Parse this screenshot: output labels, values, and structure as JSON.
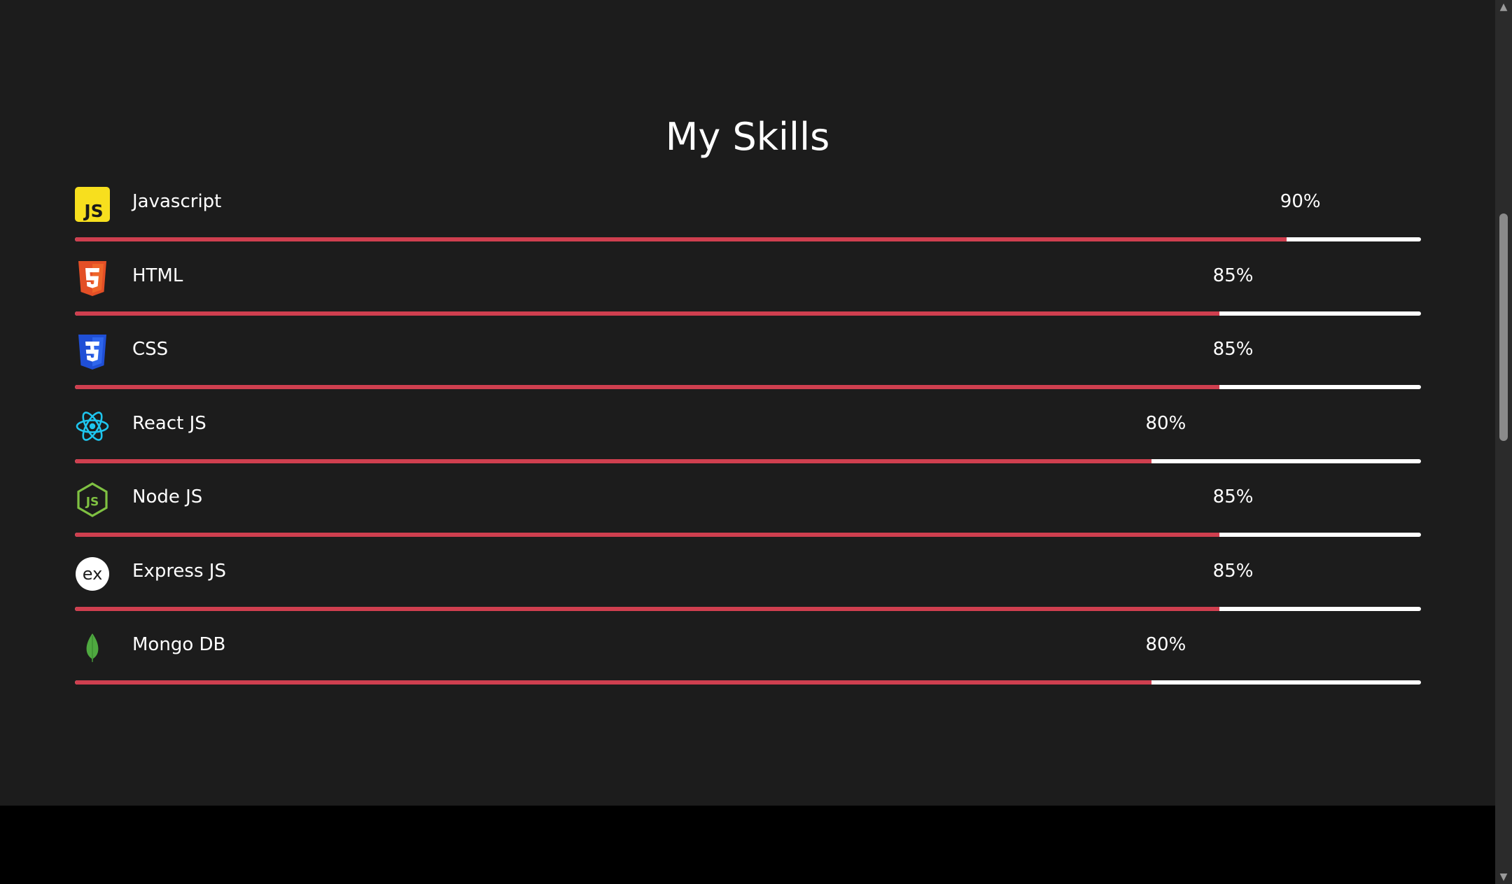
{
  "section": {
    "title": "My Skills"
  },
  "colors": {
    "background": "#1c1c1c",
    "bar_fill": "#cf3f4f",
    "bar_track": "#ffffff",
    "text": "#ffffff"
  },
  "skills": [
    {
      "name": "Javascript",
      "percent_label": "90%",
      "level": 0.9,
      "icon": "javascript-icon"
    },
    {
      "name": "HTML",
      "percent_label": "85%",
      "level": 0.85,
      "icon": "html5-icon"
    },
    {
      "name": "CSS",
      "percent_label": "85%",
      "level": 0.85,
      "icon": "css3-icon"
    },
    {
      "name": "React JS",
      "percent_label": "80%",
      "level": 0.8,
      "icon": "react-icon"
    },
    {
      "name": "Node JS",
      "percent_label": "85%",
      "level": 0.85,
      "icon": "nodejs-icon"
    },
    {
      "name": "Express JS",
      "percent_label": "85%",
      "level": 0.85,
      "icon": "express-icon"
    },
    {
      "name": "Mongo DB",
      "percent_label": "80%",
      "level": 0.8,
      "icon": "mongodb-icon"
    }
  ]
}
